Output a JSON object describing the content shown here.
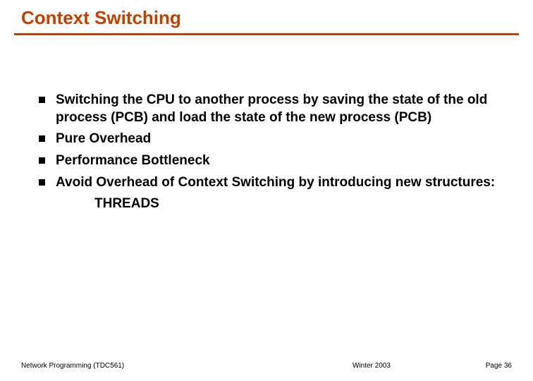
{
  "slide": {
    "title": "Context Switching",
    "bullets": [
      "Switching the CPU to another process by saving the state of the old process (PCB) and load the state of the new process (PCB)",
      "Pure Overhead",
      "Performance Bottleneck",
      "Avoid Overhead of Context Switching by introducing new structures:"
    ],
    "sub_line": "THREADS",
    "footer": {
      "left": "Network Programming (TDC561)",
      "center": "Winter  2003",
      "right": "Page 36"
    }
  }
}
